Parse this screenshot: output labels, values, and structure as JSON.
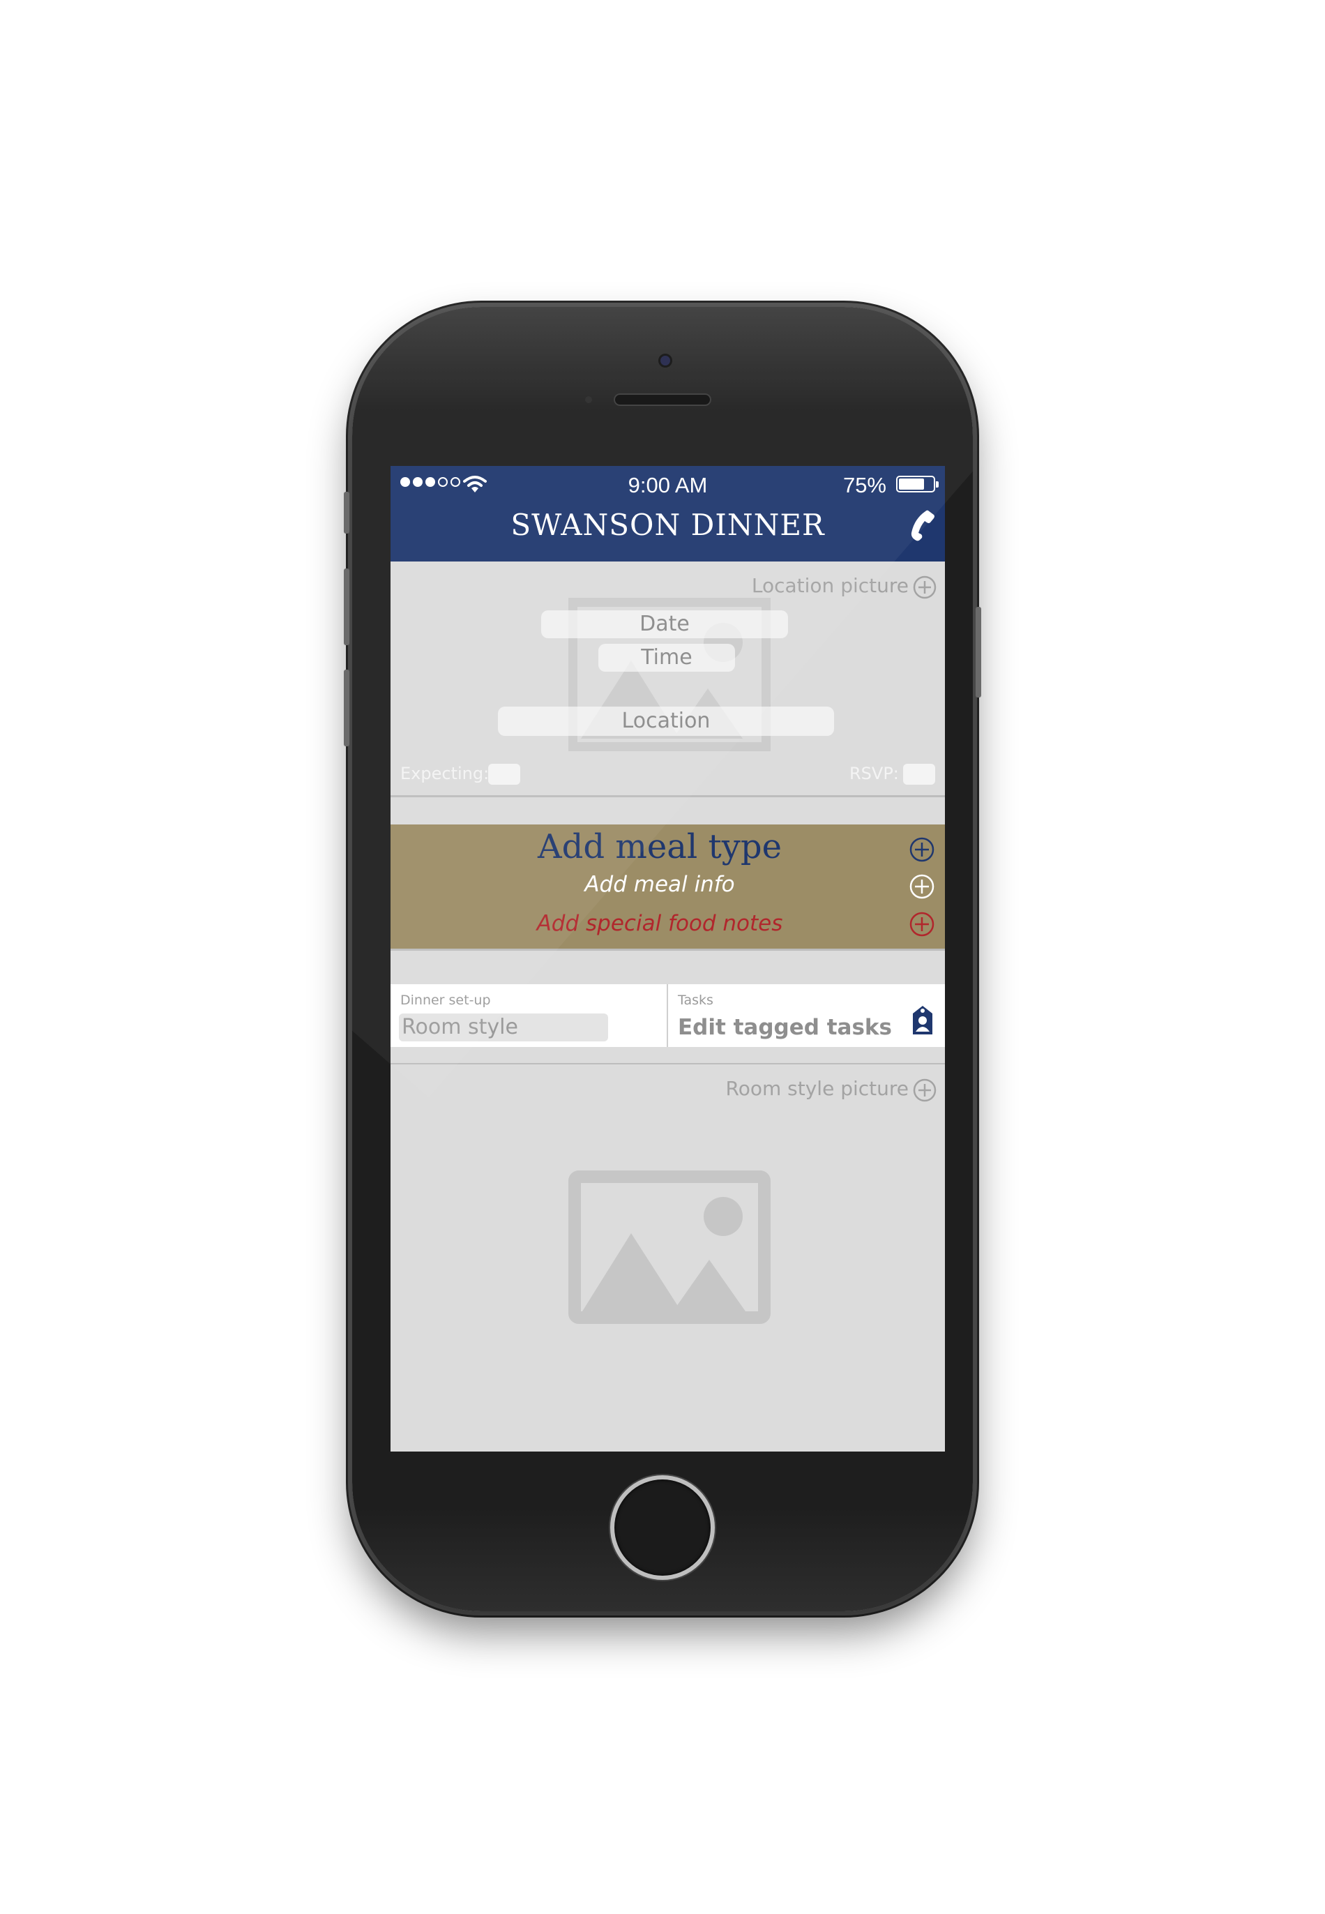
{
  "status_bar": {
    "time": "9:00 AM",
    "battery_percent": "75%",
    "battery_level": 0.75,
    "signal_bars_filled": 3,
    "signal_bars_total": 5
  },
  "header": {
    "title": "SWANSON DINNER",
    "call_icon": "phone-icon"
  },
  "location_section": {
    "picture_label": "Location picture",
    "date_placeholder": "Date",
    "time_placeholder": "Time",
    "location_placeholder": "Location",
    "expecting_label": "Expecting:",
    "rsvp_label": "RSVP:"
  },
  "meal_section": {
    "meal_type": "Add meal type",
    "meal_info": "Add meal info",
    "special_notes": "Add special food notes"
  },
  "setup_row": {
    "dinner_setup_caption": "Dinner set-up",
    "room_style_placeholder": "Room style",
    "tasks_caption": "Tasks",
    "tasks_text": "Edit tagged tasks"
  },
  "room_section": {
    "picture_label": "Room style picture"
  },
  "colors": {
    "header_blue": "#1f376e",
    "meal_tan": "#9c8d66",
    "notes_red": "#b1262c",
    "screen_gray": "#dcdcdc"
  }
}
